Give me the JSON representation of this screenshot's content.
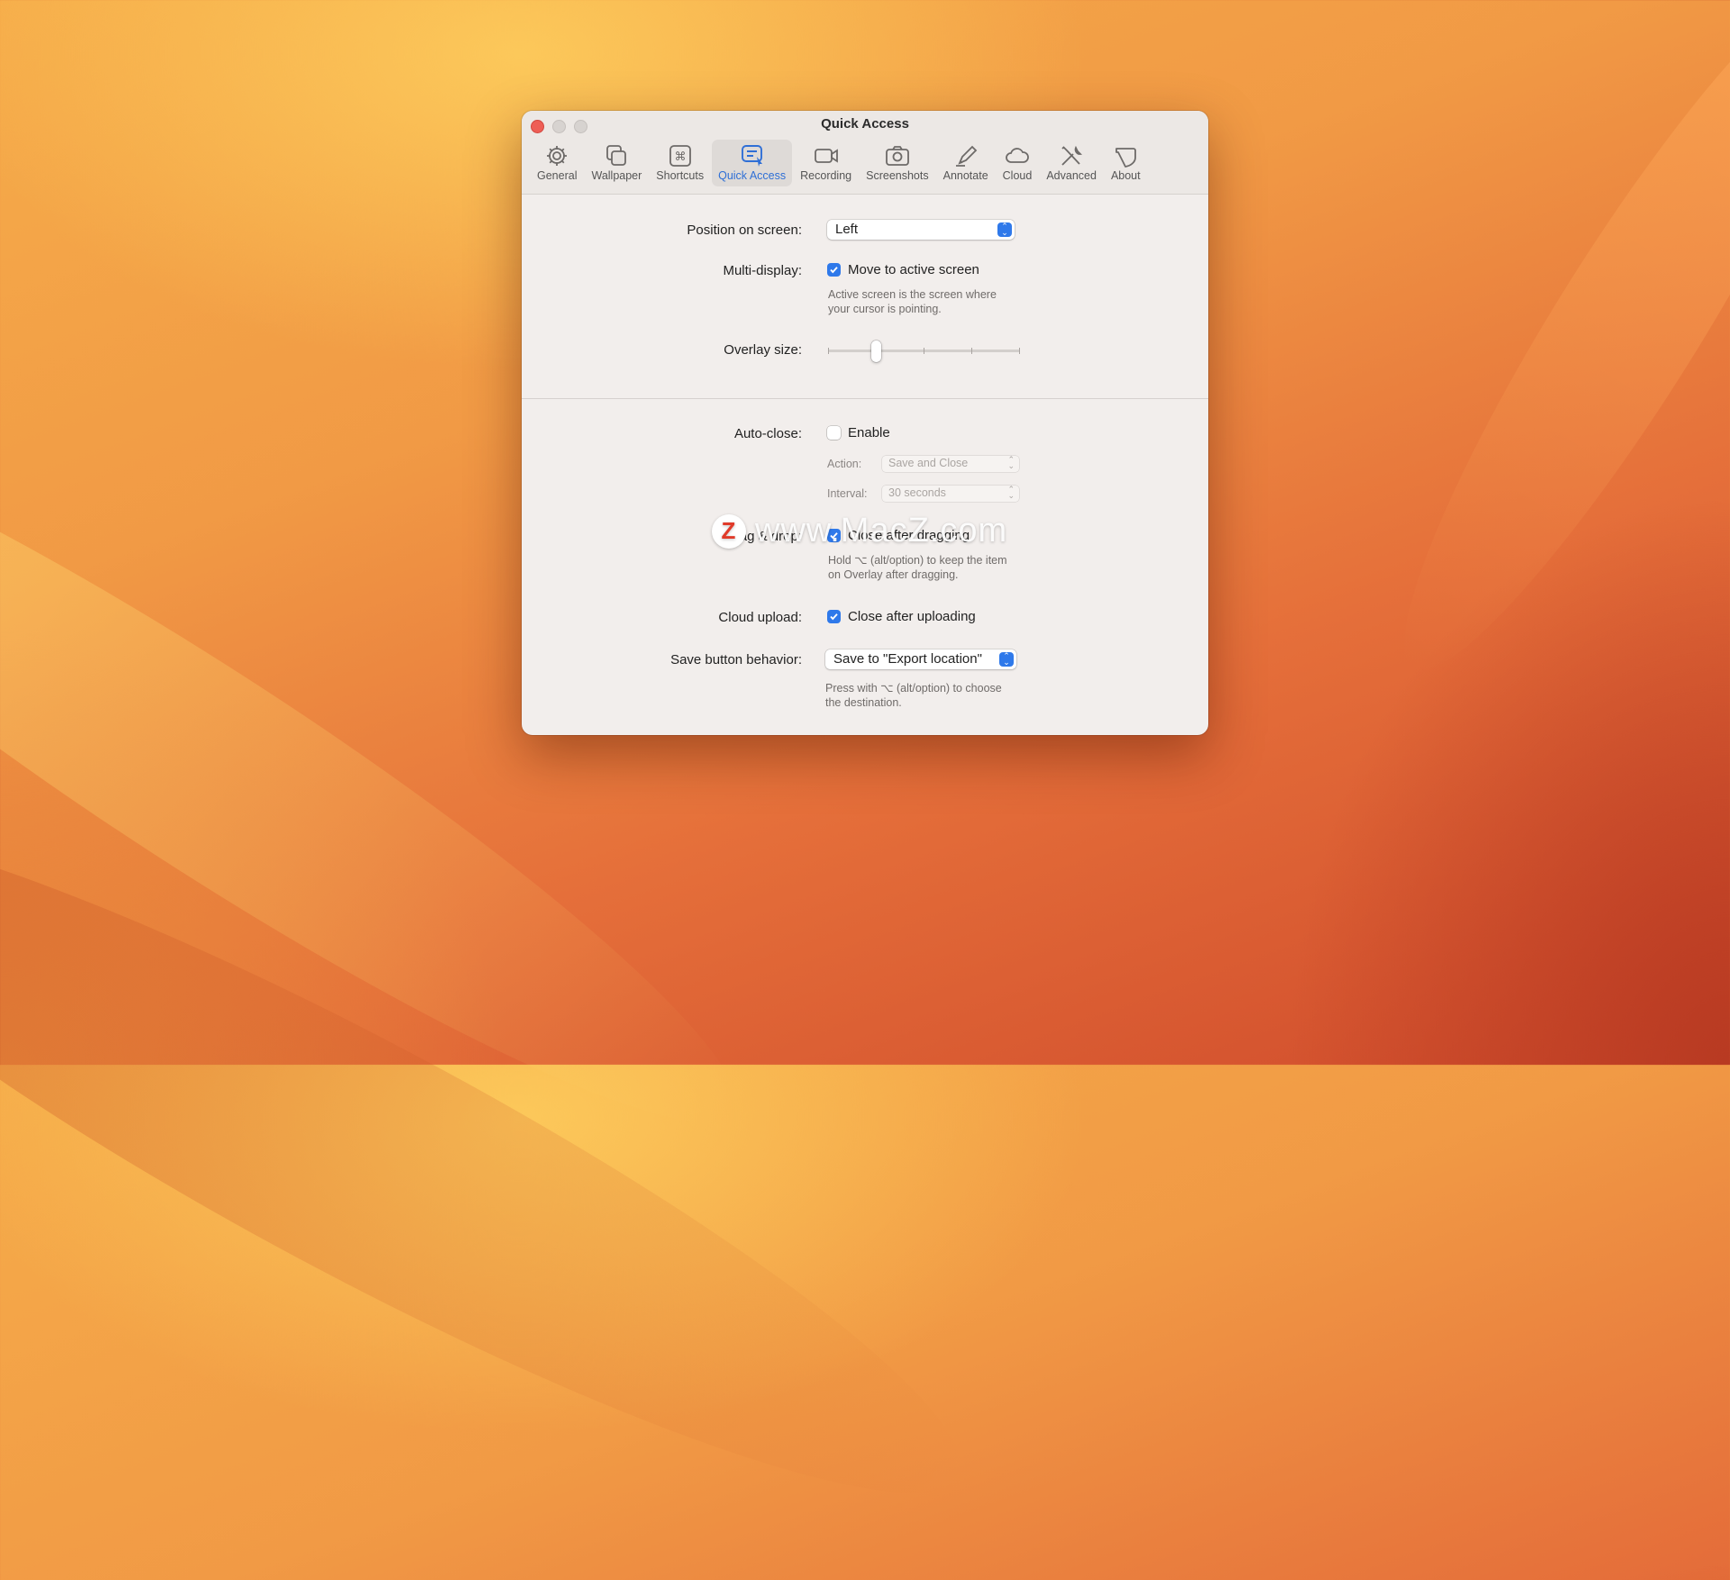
{
  "window": {
    "title": "Quick Access"
  },
  "toolbar": {
    "items": [
      {
        "label": "General",
        "icon": "gear-icon"
      },
      {
        "label": "Wallpaper",
        "icon": "wallpaper-icon"
      },
      {
        "label": "Shortcuts",
        "icon": "command-key-icon"
      },
      {
        "label": "Quick Access",
        "icon": "quick-access-icon",
        "active": true
      },
      {
        "label": "Recording",
        "icon": "video-camera-icon"
      },
      {
        "label": "Screenshots",
        "icon": "camera-icon"
      },
      {
        "label": "Annotate",
        "icon": "pencil-icon"
      },
      {
        "label": "Cloud",
        "icon": "cloud-icon"
      },
      {
        "label": "Advanced",
        "icon": "tools-icon"
      },
      {
        "label": "About",
        "icon": "about-icon"
      }
    ]
  },
  "settings": {
    "position": {
      "label": "Position on screen:",
      "value": "Left"
    },
    "multi_display": {
      "label": "Multi-display:",
      "checkbox_label": "Move to active screen",
      "checked": true,
      "help_line1": "Active screen is the screen where",
      "help_line2": "your cursor is pointing."
    },
    "overlay_size": {
      "label": "Overlay size:",
      "level_fraction": 0.25,
      "ticks": 5
    },
    "auto_close": {
      "label": "Auto-close:",
      "checkbox_label": "Enable",
      "checked": false,
      "action_label": "Action:",
      "action_value": "Save and Close",
      "interval_label": "Interval:",
      "interval_value": "30 seconds"
    },
    "drag_drop": {
      "label": "Drag & drop:",
      "checkbox_label": "Close after dragging",
      "checked": true,
      "help_line1": "Hold ⌥ (alt/option) to keep the item",
      "help_line2": "on Overlay after dragging."
    },
    "cloud_upload": {
      "label": "Cloud upload:",
      "checkbox_label": "Close after uploading",
      "checked": true
    },
    "save_button": {
      "label": "Save button behavior:",
      "value": "Save to \"Export location\"",
      "help_line1": "Press with ⌥ (alt/option) to choose",
      "help_line2": "the destination."
    }
  },
  "watermark": {
    "logo": "Z",
    "text": "www.MacZ.com"
  },
  "colors": {
    "accent": "#2f79ea",
    "close_light": "#ee5e56"
  }
}
